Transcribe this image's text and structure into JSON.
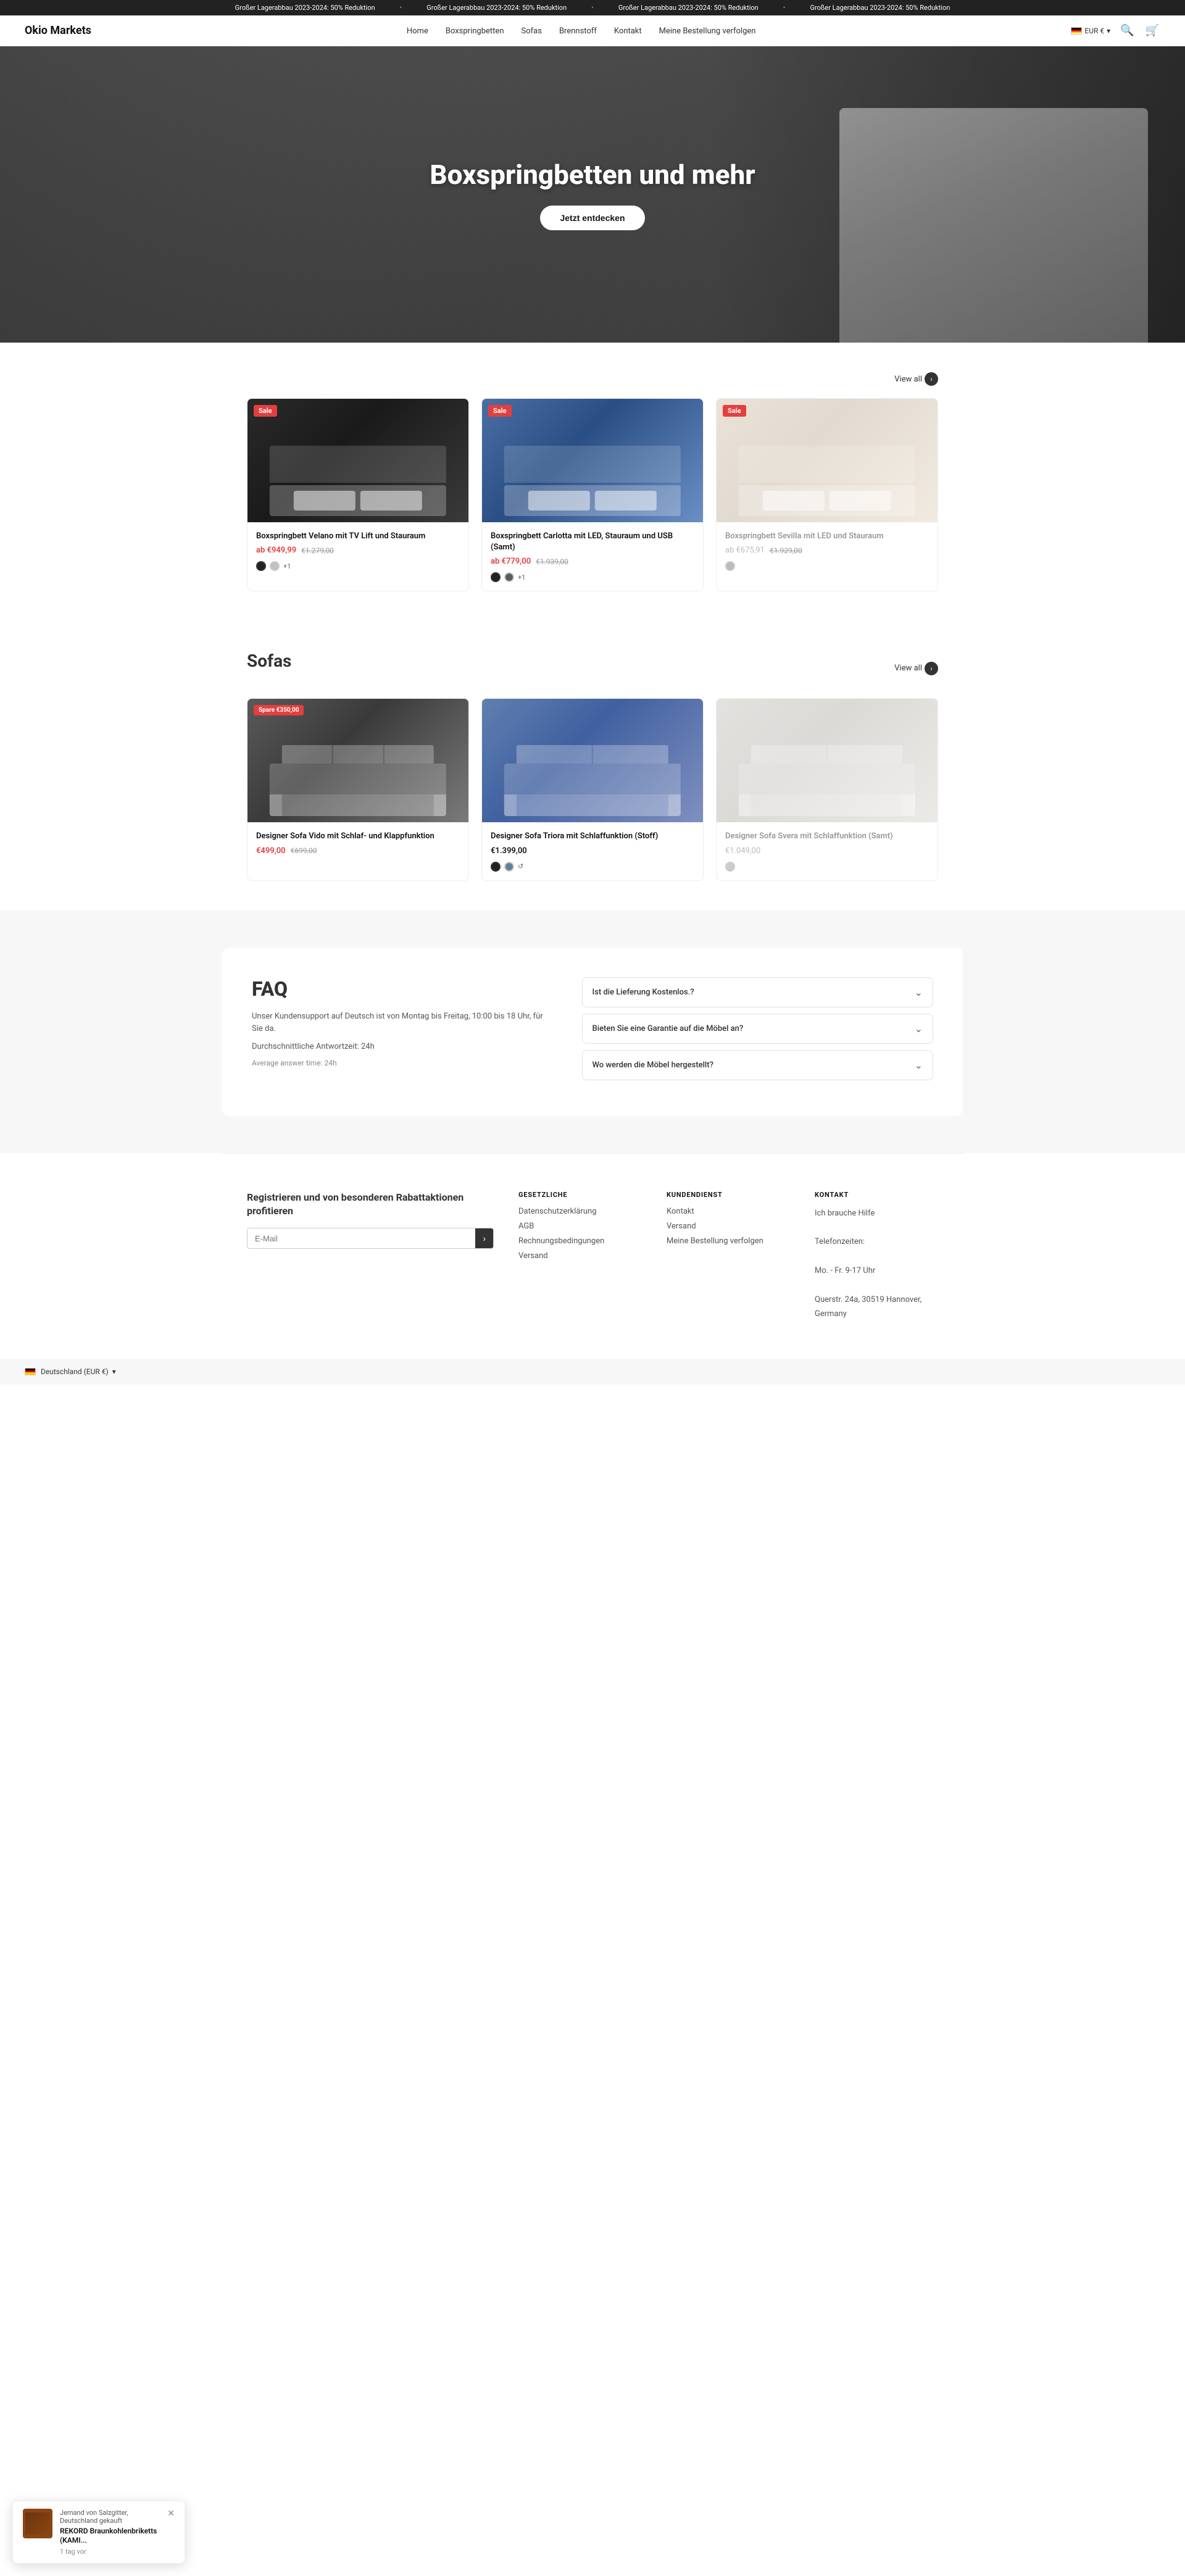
{
  "announcement": {
    "items": [
      "Großer Lagerabbau 2023-2024: 50% Reduktion",
      "Großer Lagerabbau 2023-2024: 50% Reduktion",
      "Großer Lagerabbau 2023-2024: 50% Reduktion",
      "Großer Lagerabbau 2023-2024: 50% Reduktion"
    ]
  },
  "header": {
    "logo": "Okio Markets",
    "nav": [
      {
        "label": "Home",
        "href": "#"
      },
      {
        "label": "Boxspringbetten",
        "href": "#"
      },
      {
        "label": "Sofas",
        "href": "#"
      },
      {
        "label": "Brennstoff",
        "href": "#"
      },
      {
        "label": "Kontakt",
        "href": "#"
      },
      {
        "label": "Meine Bestellung verfolgen",
        "href": "#"
      }
    ],
    "currency": "EUR €",
    "currency_chevron": "▾"
  },
  "hero": {
    "title": "Boxspringbetten und mehr",
    "cta_label": "Jetzt entdecken"
  },
  "beds_section": {
    "view_all_label": "View all",
    "products": [
      {
        "name": "Boxspringbett Velano mit TV Lift und Stauraum",
        "price": "ab €949,99",
        "original_price": "€1.279,00",
        "badge": "Sale",
        "colors": [
          "#222",
          "#c0c0c0"
        ],
        "color_extra": "+1",
        "faded": false
      },
      {
        "name": "Boxspringbett Carlotta mit LED, Stauraum und USB (Samt)",
        "price": "ab €779,00",
        "original_price": "€1.939,00",
        "badge": "Sale",
        "colors": [
          "#222",
          "#5a5a5a"
        ],
        "color_extra": "+1",
        "faded": false
      },
      {
        "name": "Boxspringbett Sevilla mit LED und Stauraum",
        "price": "ab €675,91",
        "original_price": "€1.929,00",
        "badge": "Sale",
        "colors": [],
        "color_extra": "",
        "faded": true
      }
    ]
  },
  "sofas_section": {
    "title": "Sofas",
    "view_all_label": "View all",
    "products": [
      {
        "name": "Designer Sofa Vido mit Schlaf- und Klappfunktion",
        "price": "€499,00",
        "original_price": "€699,00",
        "badge": "Spare €350,00",
        "badge_type": "savings",
        "colors": [],
        "color_extra": "",
        "faded": false
      },
      {
        "name": "Designer Sofa Triora mit Schlaffunktion (Stoff)",
        "price": "€1.399,00",
        "original_price": "",
        "badge": null,
        "colors": [
          "#222",
          "#6080a0"
        ],
        "color_extra": "↺",
        "faded": false
      },
      {
        "name": "Designer Sofa Svera mit Schlaffunktion (Samt)",
        "price": "€1.049,00",
        "original_price": "",
        "badge": null,
        "colors": [],
        "color_extra": "",
        "faded": true
      }
    ]
  },
  "faq": {
    "title": "FAQ",
    "description": "Unser Kundensupport auf Deutsch ist von Montag bis Freitag, 10:00 bis 18 Uhr, für Sie da.",
    "response_time": "Durchschnittliche Antwortzeit: 24h",
    "response_time_en": "Average answer time: 24h",
    "items": [
      {
        "question": "Ist die Lieferung Kostenlos.?"
      },
      {
        "question": "Bieten Sie eine Garantie auf die Möbel an?"
      },
      {
        "question": "Wo werden die Möbel hergestellt?"
      }
    ]
  },
  "footer": {
    "register_title": "Registrieren und von besonderen Rabattaktionen profitieren",
    "email_placeholder": "E-Mail",
    "columns": [
      {
        "title": "GESETZLICHE",
        "links": [
          "Datenschutzerklärung",
          "AGB",
          "Rechnungsbedingungen",
          "Versand"
        ]
      },
      {
        "title": "KUNDENDIENST",
        "links": [
          "Kontakt",
          "Versand",
          "Meine Bestellung verfolgen"
        ]
      },
      {
        "title": "Kontakt",
        "lines": [
          "Ich brauche Hilfe",
          "",
          "Telefonzeiten:",
          "",
          "Mo. - Fr. 9-17 Uhr",
          "",
          "Querstr. 24a, 30519 Hannover, Germany"
        ]
      }
    ]
  },
  "footer_bottom": {
    "currency": "Deutschland (EUR €)",
    "chevron": "▾"
  },
  "toast": {
    "title_text": "Jemand von Salzgitter, Deutschland gekauft",
    "product": "REKORD Braunkohlenbriketts (KAMI...",
    "time": "1 tag vor"
  }
}
